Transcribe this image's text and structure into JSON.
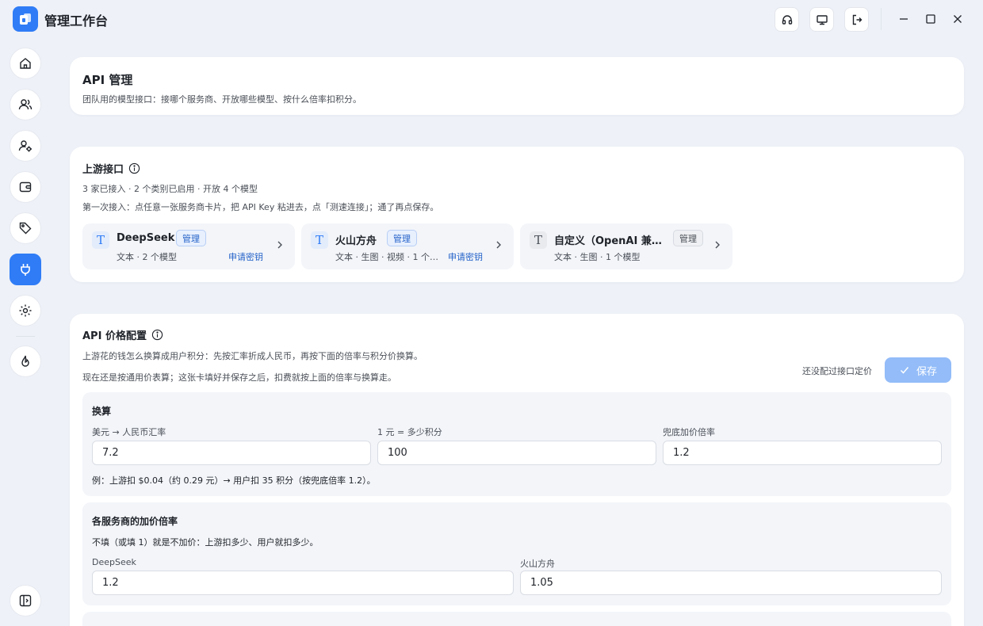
{
  "app": {
    "title": "管理工作台"
  },
  "colors": {
    "accent": "#2f7cf6",
    "link": "#2563c9",
    "save_disabled": "#93bcf8"
  },
  "titlebar_icons": [
    "headset-icon",
    "monitor-icon",
    "logout-icon",
    "minimize-icon",
    "maximize-icon",
    "close-icon"
  ],
  "sidebar": {
    "items": [
      "home-icon",
      "users-icon",
      "user-settings-icon",
      "wallet-icon",
      "tag-icon",
      "plug-icon",
      "gear-icon",
      "flame-icon"
    ],
    "active": "plug-icon",
    "collapse_icon": "sidebar-collapse-icon"
  },
  "header": {
    "title": "API 管理",
    "subtitle": "团队用的模型接口：接哪个服务商、开放哪些模型、按什么倍率扣积分。"
  },
  "upstream": {
    "title": "上游接口",
    "summary": "3 家已接入 · 2 个类别已启用 · 开放 4 个模型",
    "hint": "第一次接入：点任意一张服务商卡片，把 API Key 粘进去，点「测速连接」；通了再点保存。",
    "providers": [
      {
        "name": "DeepSeek",
        "badge": "管理",
        "meta": "文本 · 2 个模型",
        "link": "申请密钥"
      },
      {
        "name": "火山方舟",
        "badge": "管理",
        "meta": "文本 · 生图 · 视频 · 1 个…",
        "link": "申请密钥"
      },
      {
        "name": "自定义（OpenAI 兼…",
        "badge": "管理",
        "meta": "文本 · 生图 · 1 个模型",
        "link": ""
      }
    ]
  },
  "pricing": {
    "title": "API 价格配置",
    "desc1": "上游花的钱怎么换算成用户积分：先按汇率折成人民币，再按下面的倍率与积分价换算。",
    "desc2": "现在还是按通用价表算；这张卡填好并保存之后，扣费就按上面的倍率与换算走。",
    "status": "还没配过接口定价",
    "save_label": "保存",
    "conversion": {
      "title": "换算",
      "fields": [
        {
          "label": "美元 → 人民币汇率",
          "value": "7.2"
        },
        {
          "label": "1 元 = 多少积分",
          "value": "100"
        },
        {
          "label": "兜底加价倍率",
          "value": "1.2"
        }
      ],
      "example": "例：上游扣 $0.04（约 0.29 元）→ 用户扣 35 积分（按兜底倍率 1.2）。"
    },
    "markup": {
      "title": "各服务商的加价倍率",
      "desc": "不填（或填 1）就是不加价：上游扣多少、用户就扣多少。",
      "fields": [
        {
          "label": "DeepSeek",
          "value": "1.2"
        },
        {
          "label": "火山方舟",
          "value": "1.05"
        }
      ]
    }
  }
}
